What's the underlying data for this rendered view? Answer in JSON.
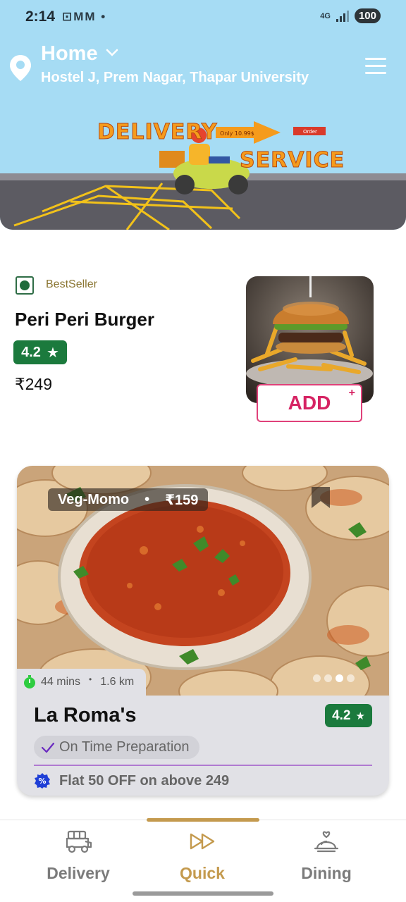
{
  "status_bar": {
    "time": "2:14",
    "notification_icons": "⊡MM •",
    "network": "4G",
    "battery": "100"
  },
  "location": {
    "title": "Home",
    "address": "Hostel J, Prem Nagar, Thapar University"
  },
  "banner": {
    "word_1": "DELIVERY",
    "word_2": "SERVICE",
    "tag_price": "Only 10.99$",
    "tag_order": "Order"
  },
  "product": {
    "tag": "BestSeller",
    "name": "Peri Peri Burger",
    "rating": "4.2",
    "price": "₹249",
    "add_label": "ADD",
    "add_plus": "+"
  },
  "restaurant": {
    "dish": "Veg-Momo",
    "dish_separator": "•",
    "dish_price": "₹159",
    "time": "44 mins",
    "info_separator": "•",
    "distance": "1.6 km",
    "name": "La Roma's",
    "rating": "4.2",
    "tag": "On Time Preparation",
    "offer": "Flat 50 OFF on above 249",
    "carousel_active_index": 3,
    "carousel_count": 4
  },
  "bottom_nav": {
    "items": [
      {
        "label": "Delivery",
        "icon": "delivery-cart-icon"
      },
      {
        "label": "Quick",
        "icon": "fast-forward-icon"
      },
      {
        "label": "Dining",
        "icon": "cloche-icon"
      }
    ],
    "active": "Quick"
  },
  "colors": {
    "header_bg": "#a6dcf4",
    "rating_green": "#1b7a3d",
    "add_pink": "#d62363",
    "accent_gold": "#c49a4e",
    "offer_divider": "#b07ad1"
  }
}
